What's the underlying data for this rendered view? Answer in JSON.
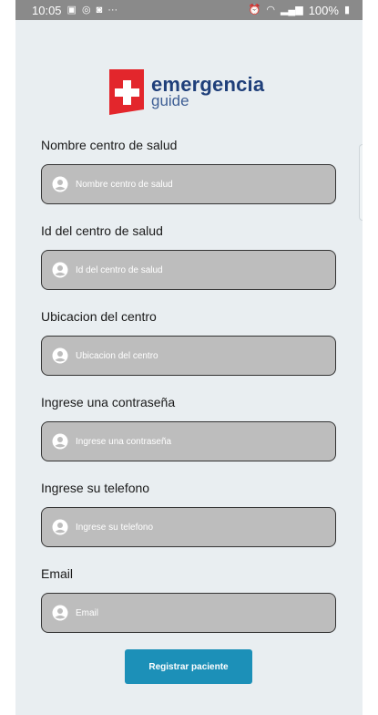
{
  "status_bar": {
    "time": "10:05",
    "left_icons": [
      "image-icon",
      "whatsapp-icon",
      "instagram-icon",
      "more-dots-icon"
    ],
    "battery": "100%"
  },
  "brand": {
    "word1": "emergencia",
    "word2": "guide"
  },
  "form": {
    "fields": [
      {
        "label": "Nombre centro de salud",
        "placeholder": "Nombre centro de salud"
      },
      {
        "label": "Id del centro de salud",
        "placeholder": "Id del centro de salud"
      },
      {
        "label": "Ubicacion del centro",
        "placeholder": "Ubicacion del centro"
      },
      {
        "label": "Ingrese una contraseña",
        "placeholder": "Ingrese una contraseña"
      },
      {
        "label": "Ingrese su telefono",
        "placeholder": "Ingrese su telefono"
      },
      {
        "label": "Email",
        "placeholder": "Email"
      }
    ],
    "submit_label": "Registrar paciente"
  },
  "colors": {
    "accent": "#1c90b8",
    "logo_red": "#e3262c",
    "logo_blue": "#1f3f7a",
    "field_bg": "#bdbdbd"
  }
}
